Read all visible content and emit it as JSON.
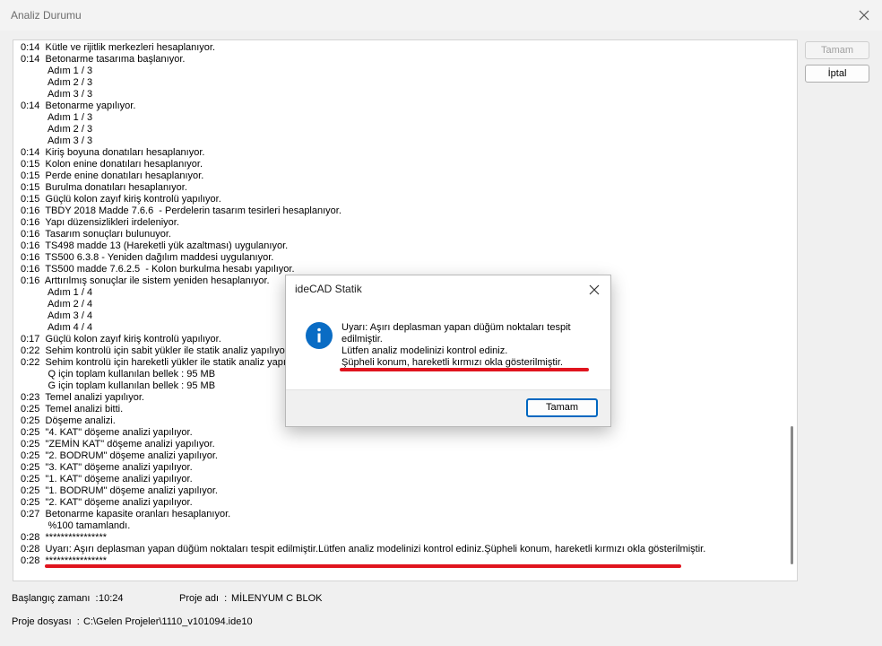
{
  "window": {
    "title": "Analiz Durumu"
  },
  "log": {
    "lines": [
      "0:14  Kütle ve rijitlik merkezleri hesaplanıyor.",
      "0:14  Betonarme tasarıma başlanıyor.",
      "          Adım 1 / 3",
      "          Adım 2 / 3",
      "          Adım 3 / 3",
      "0:14  Betonarme yapılıyor.",
      "          Adım 1 / 3",
      "          Adım 2 / 3",
      "          Adım 3 / 3",
      "0:14  Kiriş boyuna donatıları hesaplanıyor.",
      "0:15  Kolon enine donatıları hesaplanıyor.",
      "0:15  Perde enine donatıları hesaplanıyor.",
      "0:15  Burulma donatıları hesaplanıyor.",
      "0:15  Güçlü kolon zayıf kiriş kontrolü yapılıyor.",
      "0:16  TBDY 2018 Madde 7.6.6  - Perdelerin tasarım tesirleri hesaplanıyor.",
      "0:16  Yapı düzensizlikleri irdeleniyor.",
      "0:16  Tasarım sonuçları bulunuyor.",
      "0:16  TS498 madde 13 (Hareketli yük azaltması) uygulanıyor.",
      "0:16  TS500 6.3.8 - Yeniden dağılım maddesi uygulanıyor.",
      "0:16  TS500 madde 7.6.2.5  - Kolon burkulma hesabı yapılıyor.",
      "0:16  Arttırılmış sonuçlar ile sistem yeniden hesaplanıyor.",
      "          Adım 1 / 4",
      "          Adım 2 / 4",
      "          Adım 3 / 4",
      "          Adım 4 / 4",
      "0:17  Güçlü kolon zayıf kiriş kontrolü yapılıyor.",
      "0:22  Sehim kontrolü için sabit yükler ile statik analiz yapılıyor.",
      "0:22  Sehim kontrolü için hareketli yükler ile statik analiz yapılıyor.",
      "          Q için toplam kullanılan bellek : 95 MB",
      "          G için toplam kullanılan bellek : 95 MB",
      "0:23  Temel analizi yapılıyor.",
      "0:25  Temel analizi bitti.",
      "0:25  Döşeme analizi.",
      "0:25  \"4. KAT\" döşeme analizi yapılıyor.",
      "0:25  \"ZEMİN KAT\" döşeme analizi yapılıyor.",
      "0:25  \"2. BODRUM\" döşeme analizi yapılıyor.",
      "0:25  \"3. KAT\" döşeme analizi yapılıyor.",
      "0:25  \"1. KAT\" döşeme analizi yapılıyor.",
      "0:25  \"1. BODRUM\" döşeme analizi yapılıyor.",
      "0:25  \"2. KAT\" döşeme analizi yapılıyor.",
      "0:27  Betonarme kapasite oranları hesaplanıyor.",
      "          %100 tamamlandı.",
      "0:28  ****************",
      "0:28  Uyarı: Aşırı deplasman yapan düğüm noktaları tespit edilmiştir.Lütfen analiz modelinizi kontrol ediniz.Şüpheli konum, hareketli kırmızı okla gösterilmiştir.",
      "0:28  ****************"
    ]
  },
  "buttons": {
    "ok": "Tamam",
    "cancel": "İptal"
  },
  "status": {
    "start_label": "Başlangıç zamanı  :",
    "start_value": "10:24",
    "project_label": "Proje adı  :",
    "project_value": "MİLENYUM C BLOK",
    "file_label": "Proje dosyası  :",
    "file_value": "C:\\Gelen Projeler\\1110_v101094.ide10"
  },
  "dialog": {
    "title": "ideCAD Statik",
    "icon": "info-icon",
    "message_lines": [
      "Uyarı: Aşırı deplasman yapan düğüm noktaları tespit",
      "edilmiştir.",
      "Lütfen analiz modelinizi kontrol ediniz.",
      "Şüpheli konum, hareketli kırmızı okla gösterilmiştir."
    ],
    "ok": "Tamam"
  },
  "colors": {
    "accent": "#0067c0",
    "annotation": "#e0141e",
    "info": "#0a6cc4"
  }
}
